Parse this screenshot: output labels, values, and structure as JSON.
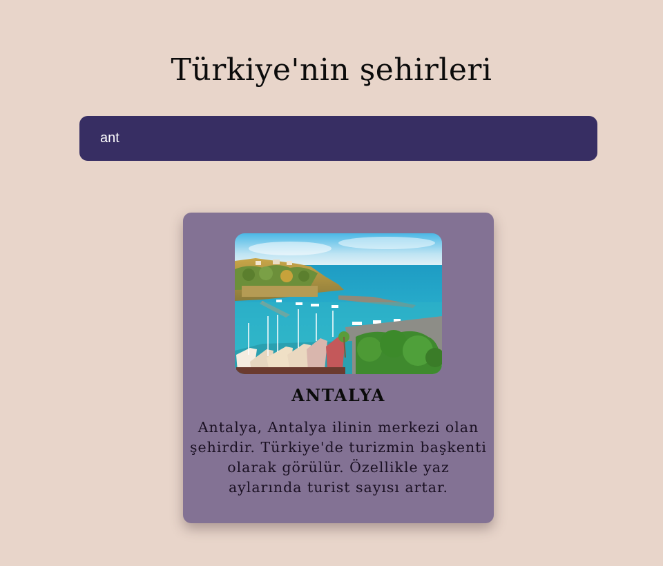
{
  "page": {
    "title": "Türkiye'nin şehirleri"
  },
  "search": {
    "value": "ant",
    "placeholder": ""
  },
  "results": [
    {
      "name": "ANTALYA",
      "image_icon": "antalya-harbor-photo",
      "description": "Antalya, Antalya ilinin merkezi olan şehirdir. Türkiye'de turizmin başkenti olarak görülür. Özellikle yaz aylarında turist sayısı artar."
    }
  ],
  "colors": {
    "background": "#e8d5ca",
    "search_bg": "#372e63",
    "card_bg": "#837294",
    "text": "#0b0b0b"
  }
}
